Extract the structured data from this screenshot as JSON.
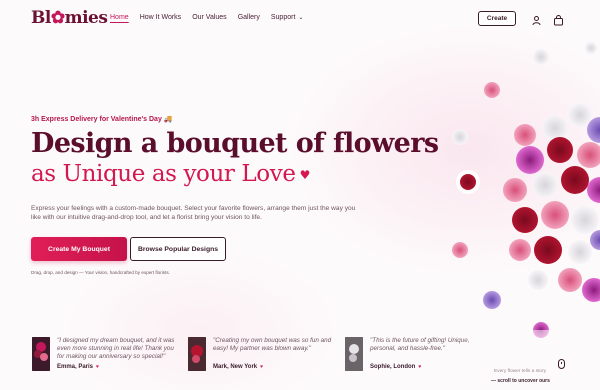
{
  "brand": {
    "logo_text_1": "Bl",
    "logo_text_2": "mies",
    "accent": "#c2185b",
    "dark": "#5a0e2b"
  },
  "nav": {
    "items": [
      {
        "label": "Home",
        "active": true
      },
      {
        "label": "How It Works"
      },
      {
        "label": "Our Values"
      },
      {
        "label": "Gallery"
      },
      {
        "label": "Support"
      }
    ],
    "support_chevron": "⌄"
  },
  "header": {
    "create_label": "Create",
    "user_icon": "user-icon",
    "bag_icon": "shopping-bag-icon"
  },
  "hero": {
    "eyebrow": "3h Express Delivery for Valentine's Day",
    "eyebrow_icon": "truck-icon",
    "headline_1": "Design a bouquet of flowers",
    "headline_2": "as Unique as your Love",
    "heart": "♥",
    "description": "Express your feelings with a custom-made bouquet. Select your favorite flowers, arrange them just the way you like with our intuitive drag-and-drop tool, and let a florist bring your vision to life.",
    "primary_cta": "Create My Bouquet",
    "secondary_cta": "Browse Popular Designs",
    "note": "Drag, drop, and design — Your vision, handcrafted by expert florists."
  },
  "testimonials": [
    {
      "quote": "\"I designed my dream bouquet, and it was even more stunning in real life! Thank you for making our anniversary so special!\"",
      "author": "Emma, Paris",
      "heart": "♥"
    },
    {
      "quote": "\"Creating my own bouquet was so fun and easy! My partner was blown away.\"",
      "author": "Mark, New York",
      "heart": "♥"
    },
    {
      "quote": "\"This is the future of gifting! Unique, personal, and hassle-free.\"",
      "author": "Sophie, London",
      "heart": "♥"
    }
  ],
  "scroll": {
    "hint_1": "Every flower tells a story",
    "hint_2": "— scroll to uncover ours"
  }
}
